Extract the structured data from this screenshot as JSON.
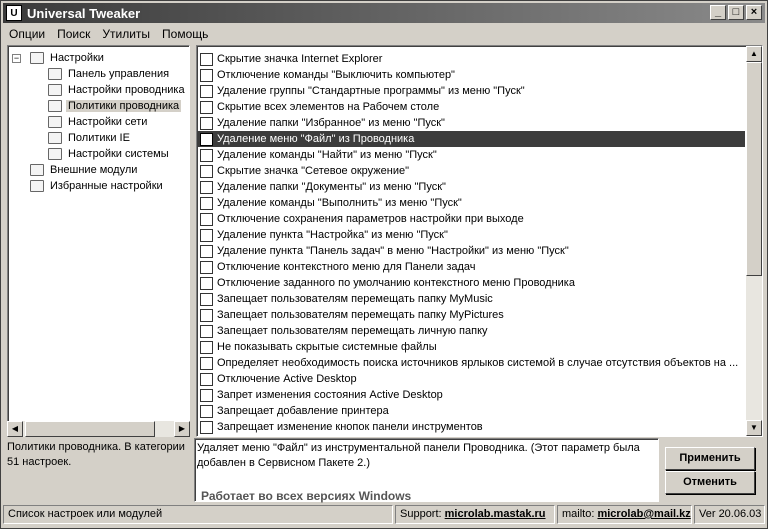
{
  "window": {
    "title": "Universal Tweaker",
    "minimize": "_",
    "maximize": "□",
    "close": "×"
  },
  "menu": [
    "Опции",
    "Поиск",
    "Утилиты",
    "Помощь"
  ],
  "tree": {
    "items": [
      {
        "label": "Настройки",
        "level": 0,
        "expander": "−"
      },
      {
        "label": "Панель управления",
        "level": 1
      },
      {
        "label": "Настройки проводника",
        "level": 1
      },
      {
        "label": "Политики проводника",
        "level": 1,
        "selected": true
      },
      {
        "label": "Настройки сети",
        "level": 1
      },
      {
        "label": "Политики IE",
        "level": 1
      },
      {
        "label": "Настройки системы",
        "level": 1
      },
      {
        "label": "Внешние модули",
        "level": 0
      },
      {
        "label": "Избранные настройки",
        "level": 0
      }
    ],
    "description": "Политики проводника. В категории 51 настроек."
  },
  "options": [
    {
      "label": "Скрытие значка Internet Explorer"
    },
    {
      "label": "Отключение команды \"Выключить компьютер\""
    },
    {
      "label": "Удаление группы \"Стандартные программы\" из меню \"Пуск\""
    },
    {
      "label": "Скрытие всех элементов на Рабочем столе"
    },
    {
      "label": "Удаление папки \"Избранное\" из меню \"Пуск\""
    },
    {
      "label": "Удаление меню \"Файл\" из Проводника",
      "selected": true
    },
    {
      "label": "Удаление команды \"Найти\" из меню \"Пуск\""
    },
    {
      "label": "Скрытие значка \"Сетевое окружение\""
    },
    {
      "label": "Удаление папки \"Документы\" из меню \"Пуск\""
    },
    {
      "label": "Удаление команды \"Выполнить\" из меню \"Пуск\""
    },
    {
      "label": "Отключение сохранения параметров настройки при выходе"
    },
    {
      "label": "Удаление пункта \"Настройка\" из меню \"Пуск\""
    },
    {
      "label": "Удаление пункта \"Панель задач\" в меню \"Настройки\" из меню \"Пуск\""
    },
    {
      "label": "Отключение контекстного меню для Панели задач"
    },
    {
      "label": "Отключение заданного по умолчанию контекстного меню Проводника"
    },
    {
      "label": "Запещает пользователям перемещать папку MyMusic"
    },
    {
      "label": "Запещает пользователям перемещать папку MyPictures"
    },
    {
      "label": "Запещает пользователям перемещать личную папку"
    },
    {
      "label": "Не показывать скрытые системные файлы"
    },
    {
      "label": "Определяет необходимость поиска источников ярлыков системой в случае отсутствия объектов на ..."
    },
    {
      "label": "Отключение Active Desktop"
    },
    {
      "label": "Запрет изменения состояния Active Desktop"
    },
    {
      "label": "Запрещает добавление принтера"
    },
    {
      "label": "Запрещает изменение кнопок панели инструментов"
    }
  ],
  "description": {
    "text": "Удаляет меню \"Файл\" из инструментальной панели Проводника. (Этот параметр была добавлен в Сервисном Пакете 2.)",
    "works": "Работает во всех версиях Windows"
  },
  "buttons": {
    "apply": "Применить",
    "cancel": "Отменить"
  },
  "status": {
    "text": "Список настроек или модулей",
    "support_label": "Support:",
    "support_link": "microlab.mastak.ru",
    "mail_label": "mailto:",
    "mail_link": "microlab@mail.kz",
    "version": "Ver 20.06.03"
  }
}
